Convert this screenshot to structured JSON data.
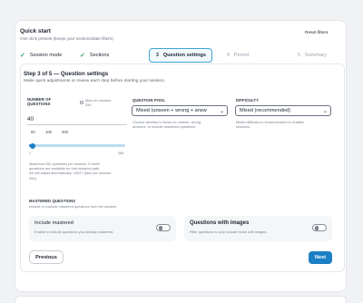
{
  "header": {
    "title": "Quick start",
    "subtitle": "One click presets (keeps your sections/date filters).",
    "reset_label": "Reset filters"
  },
  "steps": [
    {
      "label": "Session mode",
      "state": "done",
      "icon": "check-icon"
    },
    {
      "label": "Sections",
      "state": "done",
      "icon": "check-icon"
    },
    {
      "number": "3",
      "label": "Question settings",
      "state": "active"
    },
    {
      "number": "4",
      "label": "Period",
      "state": "upcoming"
    },
    {
      "number": "5",
      "label": "Summary",
      "state": "upcoming"
    }
  ],
  "panel": {
    "heading": "Step 3 of 5 — Question settings",
    "description": "Make quick adjustments or review each step before starting your session."
  },
  "questions": {
    "label_line1": "NUMBER OF",
    "label_line2": "QUESTIONS",
    "max_line1": "Max per session:",
    "max_line2": "250",
    "value": "40",
    "presets": [
      "50",
      "100",
      "200"
    ],
    "slider_min": "1",
    "slider_max": "250",
    "slider_value": 40,
    "note_line1": "Maximum 250 questions per session. If fewer",
    "note_line2": "questions are available for this blueprint path,",
    "note_line3": "we will adjust automatically. 15927 (Max per session:",
    "note_line4": "250)."
  },
  "pool": {
    "label": "QUESTION POOL",
    "selected": "Mixed (unseen + wrong + answ",
    "help_line1": "Choose whether to focus on unseen, wrong",
    "help_line2": "answers, or include answered questions."
  },
  "difficulty": {
    "label": "DIFFICULTY",
    "selected": "Mixed (recommended)",
    "help_line1": "Mixed difficulty is recommended for realistic",
    "help_line2": "sessions."
  },
  "mastered": {
    "label": "MASTERED QUESTIONS",
    "description": "Include or exclude mastered questions from the session."
  },
  "toggles": [
    {
      "title": "Include mastered",
      "desc": "Enable to include questions you already mastered.",
      "on": false
    },
    {
      "title": "Questions with images",
      "desc": "Filter questions to only include those with images.",
      "on": false
    }
  ],
  "nav": {
    "previous": "Previous",
    "next": "Next"
  },
  "colors": {
    "accent": "#1b7fc4",
    "success": "#2e9d5c",
    "active_border": "#3fa7d6"
  }
}
